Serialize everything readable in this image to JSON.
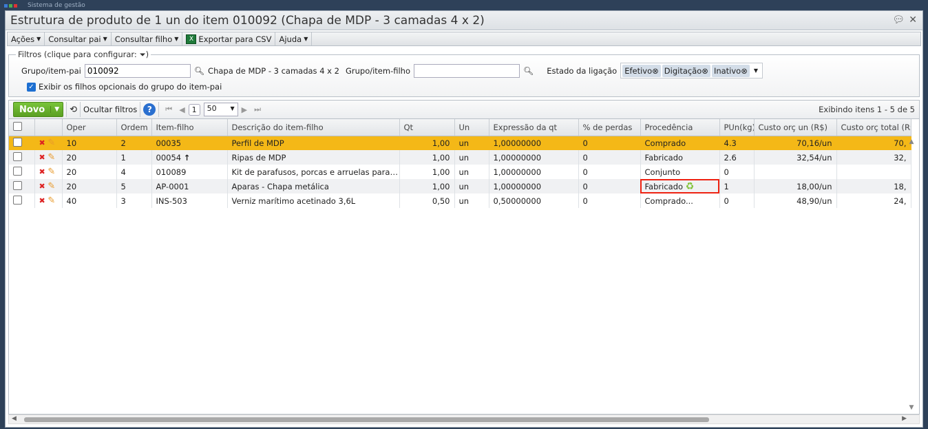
{
  "app": {
    "title": "Sistema de gestão"
  },
  "window": {
    "title": "Estrutura de produto de 1 un do item 010092 (Chapa de MDP - 3 camadas 4 x 2)"
  },
  "menu": [
    {
      "label": "Ações"
    },
    {
      "label": "Consultar pai"
    },
    {
      "label": "Consultar filho"
    },
    {
      "label": "Exportar para CSV"
    },
    {
      "label": "Ajuda"
    }
  ],
  "filters": {
    "legend": "Filtros (clique para configurar:",
    "legend_end": ")",
    "parent_label": "Grupo/item-pai",
    "parent_value": "010092",
    "parent_desc": "Chapa de MDP - 3 camadas 4 x 2",
    "child_label": "Grupo/item-filho",
    "child_value": "",
    "state_label": "Estado da ligação",
    "states": [
      "Efetivo",
      "Digitação",
      "Inativo"
    ],
    "optional_label": "Exibir os filhos opcionais do grupo do item-pai",
    "optional_checked": true
  },
  "grid_toolbar": {
    "new_label": "Novo",
    "hide_filters": "Ocultar filtros",
    "page": "1",
    "page_size": "50",
    "showing": "Exibindo itens 1 - 5 de 5"
  },
  "columns": [
    "Oper",
    "Ordem",
    "Item-filho",
    "Descrição do item-filho",
    "Qt",
    "Un",
    "Expressão da qt",
    "% de perdas",
    "Procedência",
    "PUn(kg)",
    "Custo orç un (R$)",
    "Custo orç total (R$)"
  ],
  "rows": [
    {
      "oper": "10",
      "ordem": "2",
      "item": "00035",
      "desc": "Perfil de MDP",
      "qt": "1,00",
      "un": "un",
      "expr": "1,00000000",
      "perdas": "0",
      "proc": "Comprado",
      "pun": "4.3",
      "custo_un": "70,16/un",
      "custo_total": "70,"
    },
    {
      "oper": "20",
      "ordem": "1",
      "item": "00054",
      "desc": "Ripas de MDP",
      "qt": "1,00",
      "un": "un",
      "expr": "1,00000000",
      "perdas": "0",
      "proc": "Fabricado",
      "pun": "2.6",
      "custo_un": "32,54/un",
      "custo_total": "32,"
    },
    {
      "oper": "20",
      "ordem": "4",
      "item": "010089",
      "desc": "Kit de parafusos, porcas e arruelas para p...",
      "qt": "1,00",
      "un": "un",
      "expr": "1,00000000",
      "perdas": "0",
      "proc": "Conjunto",
      "pun": "0",
      "custo_un": "",
      "custo_total": ""
    },
    {
      "oper": "20",
      "ordem": "5",
      "item": "AP-0001",
      "desc": "Aparas - Chapa metálica",
      "qt": "1,00",
      "un": "un",
      "expr": "1,00000000",
      "perdas": "0",
      "proc": "Fabricado",
      "pun": "1",
      "custo_un": "18,00/un",
      "custo_total": "18,"
    },
    {
      "oper": "40",
      "ordem": "3",
      "item": "INS-503",
      "desc": "Verniz marítimo acetinado 3,6L",
      "qt": "0,50",
      "un": "un",
      "expr": "0,50000000",
      "perdas": "0",
      "proc": "Comprado...",
      "pun": "0",
      "custo_un": "48,90/un",
      "custo_total": "24,"
    }
  ]
}
